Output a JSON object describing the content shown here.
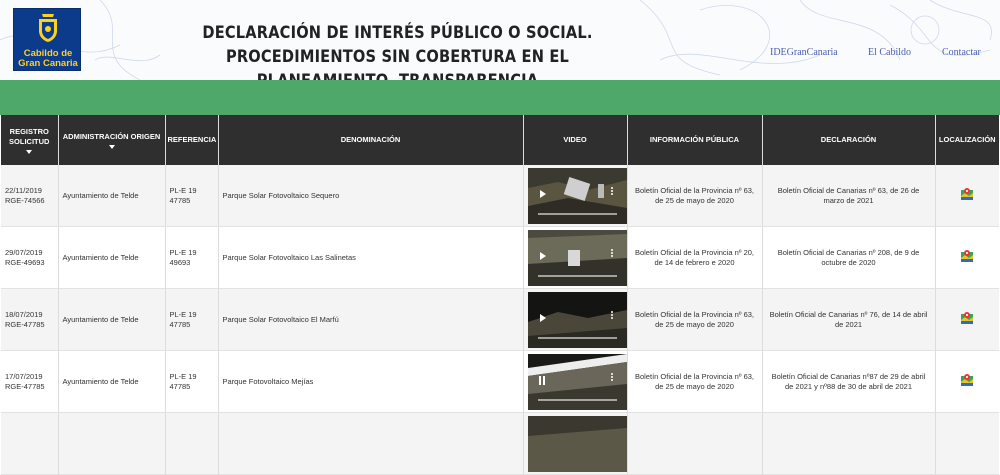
{
  "header": {
    "logo_line1": "Cabildo de",
    "logo_line2": "Gran Canaria",
    "title": "DECLARACIÓN DE INTERÉS PÚBLICO O SOCIAL. PROCEDIMIENTOS SIN COBERTURA EN EL PLANEAMIENTO. TRANSPARENCIA",
    "nav": [
      "IDEGranCanaria",
      "El Cabildo",
      "Contactar"
    ]
  },
  "colors": {
    "green_bar": "#4ea86a",
    "table_header": "#2f2f2f",
    "link": "#4a5fb0",
    "logo_blue": "#0d3b8c",
    "logo_yellow": "#ffd21a"
  },
  "table": {
    "columns": {
      "registro": "REGISTRO SOLICITUD",
      "administracion": "ADMINISTRACIÓN ORIGEN",
      "referencia": "REFERENCIA",
      "denominacion": "DENOMINACIÓN",
      "video": "VIDEO",
      "info_publica": "INFORMACIÓN PÚBLICA",
      "declaracion": "DECLARACIÓN",
      "localizacion": "LOCALIZACIÓN"
    },
    "rows": [
      {
        "fecha": "22/11/2019",
        "rge": "RGE-74566",
        "administracion": "Ayuntamiento de Telde",
        "ref1": "PL-E 19",
        "ref2": "47785",
        "denominacion": "Parque Solar Fotovoltaico Sequero",
        "video_state": "play",
        "info_publica": "Boletín Oficial de la Provincia nº 63, de 25 de mayo de 2020",
        "declaracion": "Boletín Oficial de Canarias nº 63, de 26 de marzo de 2021",
        "icon": "map-location-icon"
      },
      {
        "fecha": "29/07/2019",
        "rge": "RGE-49693",
        "administracion": "Ayuntamiento de Telde",
        "ref1": "PL-E 19",
        "ref2": "49693",
        "denominacion": "Parque Solar Fotovoltaico Las Salinetas",
        "video_state": "play",
        "info_publica": "Boletín Oficial de la Provincia nº 20, de 14 de febrero e 2020",
        "declaracion": "Boletín Oficial de Canarias nº 208, de 9 de octubre de 2020",
        "icon": "map-location-icon"
      },
      {
        "fecha": "18/07/2019",
        "rge": "RGE-47785",
        "administracion": "Ayuntamiento de Telde",
        "ref1": "PL-E 19",
        "ref2": "47785",
        "denominacion": "Parque Solar Fotovoltaico El Marfú",
        "video_state": "play",
        "info_publica": "Boletín Oficial de la Provincia nº 63, de 25 de mayo de 2020",
        "declaracion": "Boletín Oficial de Canarias nº 76, de 14 de abril de 2021",
        "icon": "map-location-icon"
      },
      {
        "fecha": "17/07/2019",
        "rge": "RGE-47785",
        "administracion": "Ayuntamiento de Telde",
        "ref1": "PL-E 19",
        "ref2": "47785",
        "denominacion": "Parque Fotovoltaico Mejías",
        "video_state": "pause",
        "info_publica": "Boletín Oficial de la Provincia nº 63, de 25 de mayo de 2020",
        "declaracion": "Boletín Oficial de Canarias nº87 de 29 de abril de 2021 y nº88 de 30 de abril de 2021",
        "icon": "map-location-icon"
      },
      {
        "fecha": "",
        "rge": "",
        "administracion": "",
        "ref1": "",
        "ref2": "",
        "denominacion": "",
        "video_state": "none",
        "info_publica": "",
        "declaracion": "",
        "icon": ""
      }
    ]
  }
}
